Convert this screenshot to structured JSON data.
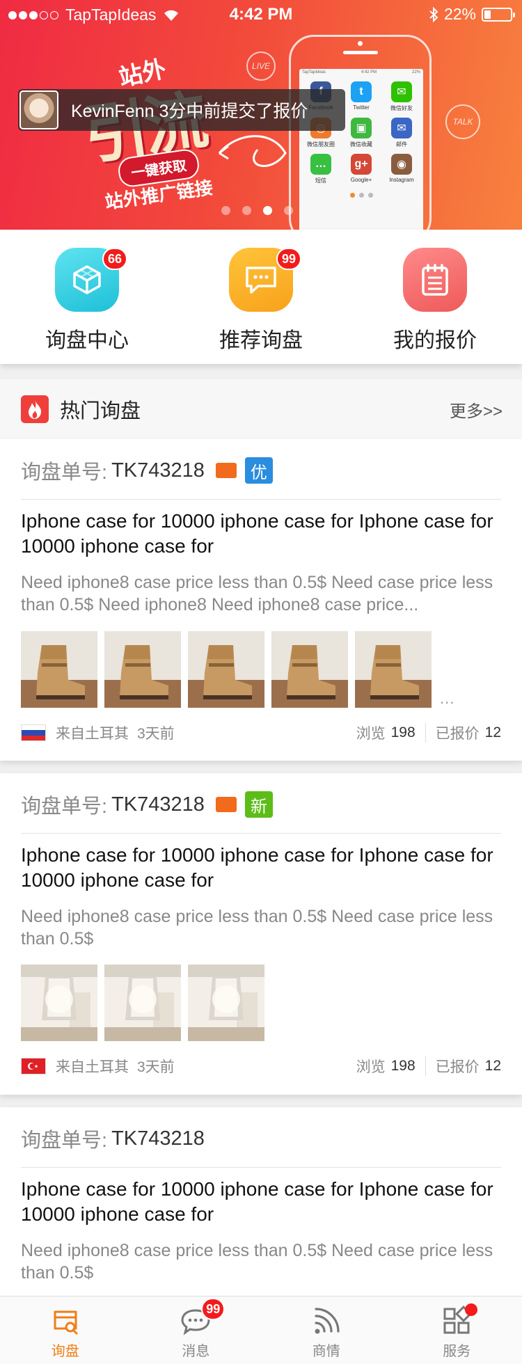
{
  "status_bar": {
    "carrier": "TapTapIdeas",
    "time": "4:42 PM",
    "battery": "22%",
    "battery_level": 0.22
  },
  "banner": {
    "promo_top": "站外",
    "promo_big": "引流",
    "promo_pill": "一键获取",
    "promo_sub": "站外推广链接",
    "deco_live": "LIVE",
    "deco_talk": "TALK",
    "phone_carrier": "TapTapIdeas",
    "phone_time": "4:42 PM",
    "phone_battery": "22%",
    "phone_apps": [
      {
        "label": "Facebook",
        "icon": "facebook-icon",
        "glyph": "f",
        "color": "#3b5998"
      },
      {
        "label": "Twitter",
        "icon": "twitter-icon",
        "glyph": "t",
        "color": "#1da1f2"
      },
      {
        "label": "微信好友",
        "icon": "wechat-icon",
        "glyph": "✉",
        "color": "#2dc100"
      },
      {
        "label": "微信朋友圈",
        "icon": "moments-icon",
        "glyph": "◎",
        "color": "#f07a2b"
      },
      {
        "label": "微信收藏",
        "icon": "favorites-icon",
        "glyph": "▣",
        "color": "#3fb83f"
      },
      {
        "label": "邮件",
        "icon": "mail-icon",
        "glyph": "✉",
        "color": "#3b66c4"
      },
      {
        "label": "短信",
        "icon": "sms-icon",
        "glyph": "…",
        "color": "#38c042"
      },
      {
        "label": "Google+",
        "icon": "google-plus-icon",
        "glyph": "g+",
        "color": "#d34836"
      },
      {
        "label": "Instagram",
        "icon": "instagram-icon",
        "glyph": "◉",
        "color": "#8a5c3e"
      }
    ],
    "notification": "KevinFenn 3分中前提交了报价",
    "page_count": 4,
    "active_page": 3
  },
  "quick_entries": [
    {
      "label": "询盘中心",
      "badge": "66",
      "icon": "inquiry-center-icon",
      "color_from": "#5fe3f0",
      "color_to": "#1ec0d8"
    },
    {
      "label": "推荐询盘",
      "badge": "99",
      "icon": "recommend-inquiry-icon",
      "color_from": "#ffc43a",
      "color_to": "#f7a21b"
    },
    {
      "label": "我的报价",
      "badge": "",
      "icon": "my-quote-icon",
      "color_from": "#ff8a8a",
      "color_to": "#ee5a5a"
    }
  ],
  "hot_section": {
    "title": "热门询盘",
    "more": "更多>>"
  },
  "cards": [
    {
      "no_label": "询盘单号:",
      "no": "TK743218",
      "has_mail": true,
      "tag": "优",
      "tag_color": "#2a8de0",
      "title": "Iphone case for 10000 iphone case for Iphone case for 10000 iphone case for",
      "desc": "Need iphone8 case price less than 0.5$ Need case price less than 0.5$ Need iphone8 Need iphone8 case price...",
      "thumbs": [
        "boot",
        "boot",
        "boot",
        "boot",
        "boot"
      ],
      "more_thumbs": "...",
      "flag": "russia",
      "from": "来自土耳其",
      "ago": "3天前",
      "views_label": "浏览",
      "views": "198",
      "quotes_label": "已报价",
      "quotes": "12"
    },
    {
      "no_label": "询盘单号:",
      "no": "TK743218",
      "has_mail": true,
      "tag": "新",
      "tag_color": "#5cbd18",
      "title": "Iphone case for 10000 iphone case for Iphone case for 10000 iphone case for",
      "desc": "Need iphone8 case price less than 0.5$ Need case price less than 0.5$",
      "thumbs": [
        "chandelier",
        "chandelier",
        "chandelier"
      ],
      "more_thumbs": "",
      "flag": "turkey",
      "from": "来自土耳其",
      "ago": "3天前",
      "views_label": "浏览",
      "views": "198",
      "quotes_label": "已报价",
      "quotes": "12"
    },
    {
      "no_label": "询盘单号:",
      "no": "TK743218",
      "has_mail": false,
      "tag": "",
      "title": "Iphone case for 10000 iphone case for Iphone case for 10000 iphone case for",
      "desc": "Need iphone8 case price less than 0.5$ Need case price less than 0.5$"
    }
  ],
  "tabbar": [
    {
      "label": "询盘",
      "icon": "inquiry-tab-icon",
      "active": true,
      "badge": "",
      "dot": false
    },
    {
      "label": "消息",
      "icon": "message-tab-icon",
      "active": false,
      "badge": "99",
      "dot": false
    },
    {
      "label": "商情",
      "icon": "feed-tab-icon",
      "active": false,
      "badge": "",
      "dot": false
    },
    {
      "label": "服务",
      "icon": "service-tab-icon",
      "active": false,
      "badge": "",
      "dot": true
    }
  ]
}
